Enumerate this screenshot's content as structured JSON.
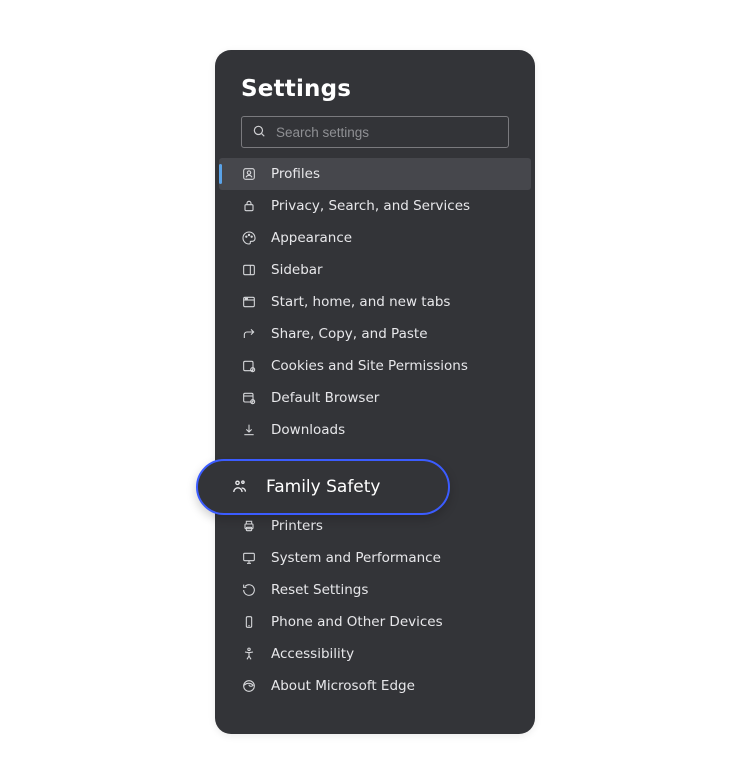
{
  "title": "Settings",
  "search": {
    "placeholder": "Search settings"
  },
  "items": [
    {
      "label": "Profiles"
    },
    {
      "label": "Privacy, Search, and Services"
    },
    {
      "label": "Appearance"
    },
    {
      "label": "Sidebar"
    },
    {
      "label": "Start, home, and new tabs"
    },
    {
      "label": "Share, Copy, and Paste"
    },
    {
      "label": "Cookies and Site Permissions"
    },
    {
      "label": "Default Browser"
    },
    {
      "label": "Downloads"
    },
    {
      "label": "Printers"
    },
    {
      "label": "System and Performance"
    },
    {
      "label": "Reset Settings"
    },
    {
      "label": "Phone and Other Devices"
    },
    {
      "label": "Accessibility"
    },
    {
      "label": "About Microsoft Edge"
    }
  ],
  "highlight": {
    "label": "Family Safety"
  }
}
